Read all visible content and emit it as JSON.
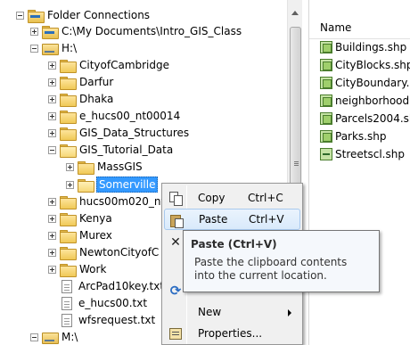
{
  "tree": {
    "root_label": "Folder Connections",
    "conn_path_label": "C:\\My Documents\\Intro_GIS_Class",
    "h_drive_label": "H:\\",
    "folders": [
      "CityofCambridge",
      "Darfur",
      "Dhaka",
      "e_hucs00_nt00014",
      "GIS_Data_Structures",
      "GIS_Tutorial_Data"
    ],
    "sub_folders": [
      "MassGIS",
      "Somerville"
    ],
    "more_folders": [
      "hucs00m020_nt",
      "Kenya",
      "Murex",
      "NewtonCityofC",
      "Work"
    ],
    "files": [
      "ArcPad10key.txt",
      "e_hucs00.txt",
      "wfsrequest.txt"
    ],
    "m_drive_label": "M:\\"
  },
  "contents": {
    "header_name": "Name",
    "items": [
      {
        "name": "Buildings.shp",
        "kind": "polygon"
      },
      {
        "name": "CityBlocks.shp",
        "kind": "polygon"
      },
      {
        "name": "CityBoundary.",
        "kind": "polygon"
      },
      {
        "name": "neighborhood",
        "kind": "polygon"
      },
      {
        "name": "Parcels2004.sh",
        "kind": "polygon"
      },
      {
        "name": "Parks.shp",
        "kind": "polygon"
      },
      {
        "name": "Streetscl.shp",
        "kind": "line"
      }
    ]
  },
  "menu": {
    "copy_label": "Copy",
    "copy_shortcut": "Ctrl+C",
    "paste_label": "Paste",
    "paste_shortcut": "Ctrl+V",
    "new_label": "New",
    "properties_label": "Properties..."
  },
  "tooltip": {
    "title": "Paste (Ctrl+V)",
    "body": "Paste the clipboard contents into the current location."
  },
  "colors": {
    "selection": "#3399ff",
    "menu_background": "#f0f0f0",
    "menu_hover": "#d9eafb",
    "tooltip_background": "#f5f8fc"
  }
}
